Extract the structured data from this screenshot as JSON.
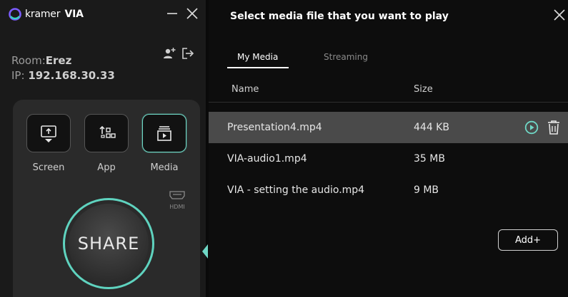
{
  "app": {
    "brand_prefix": "kramer",
    "brand_name": "VIA",
    "accent_color": "#6fd8c6"
  },
  "window_controls": {
    "minimize_icon": "minimize-icon",
    "close_icon": "close-icon"
  },
  "room": {
    "room_label": "Room:",
    "room_name": "Erez",
    "ip_label": "IP:",
    "ip_value": "192.168.30.33"
  },
  "sources": [
    {
      "label": "Screen",
      "icon": "screen-share-icon",
      "active": false
    },
    {
      "label": "App",
      "icon": "app-share-icon",
      "active": false
    },
    {
      "label": "Media",
      "icon": "media-icon",
      "active": true
    }
  ],
  "hdmi_label": "HDMI",
  "share_label": "SHARE",
  "media_dialog": {
    "title": "Select media file that you want to play",
    "tabs": [
      {
        "label": "My Media",
        "active": true
      },
      {
        "label": "Streaming",
        "active": false
      }
    ],
    "columns": {
      "name": "Name",
      "size": "Size"
    },
    "files": [
      {
        "name": "Presentation4.mp4",
        "size": "444 KB",
        "selected": true
      },
      {
        "name": "VIA-audio1.mp4",
        "size": "35 MB",
        "selected": false
      },
      {
        "name": "VIA - setting the audio.mp4",
        "size": "9 MB",
        "selected": false
      }
    ],
    "add_button": "Add+"
  }
}
